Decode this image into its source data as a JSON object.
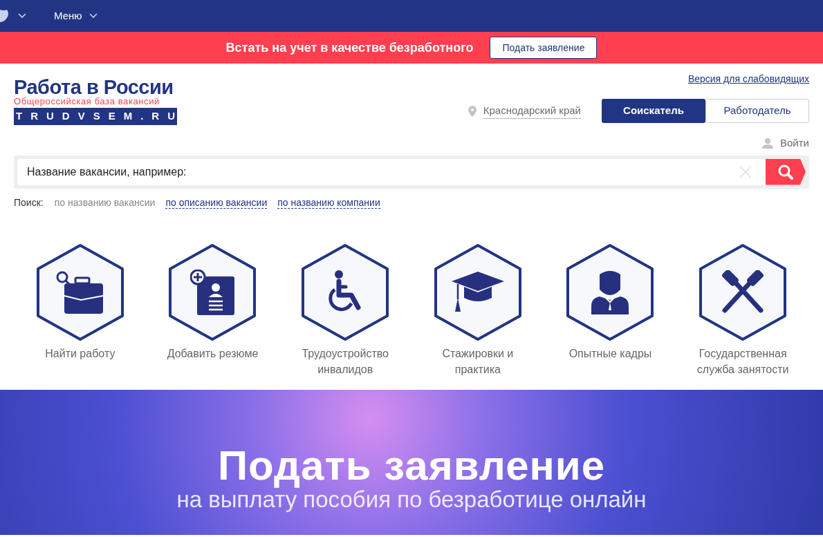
{
  "top_bar": {
    "menu_label": "Меню"
  },
  "alert_bar": {
    "text": "Встать на учет в качестве безработного",
    "button": "Подать заявление"
  },
  "logo": {
    "title": "Работа в России",
    "subtitle": "Общероссийская база вакансий",
    "domain": "TRUDVSEM.RU"
  },
  "accessibility_link": "Версия для слабовидящих",
  "region": "Краснодарский край",
  "role_tabs": [
    {
      "label": "Соискатель",
      "selected": true
    },
    {
      "label": "Работодатель",
      "selected": false
    }
  ],
  "login": "Войти",
  "search": {
    "value": "Название вакансии, например:",
    "label": "Поиск:",
    "modes": [
      {
        "label": "по названию вакансии",
        "selected": true
      },
      {
        "label": "по описанию вакансии",
        "selected": false
      },
      {
        "label": "по названию компании",
        "selected": false
      }
    ]
  },
  "services": [
    {
      "kind": "briefcase",
      "label": "Найти работу"
    },
    {
      "kind": "resume",
      "label": "Добавить резюме"
    },
    {
      "kind": "wheelchair",
      "label": "Трудоустройство инвалидов"
    },
    {
      "kind": "cap",
      "label": "Стажировки и практика"
    },
    {
      "kind": "person",
      "label": "Опытные кадры"
    },
    {
      "kind": "hammers",
      "label": "Государственная служба занятости"
    }
  ],
  "hero": {
    "title": "Подать заявление",
    "subtitle": "на выплату пособия по безработице онлайн"
  }
}
